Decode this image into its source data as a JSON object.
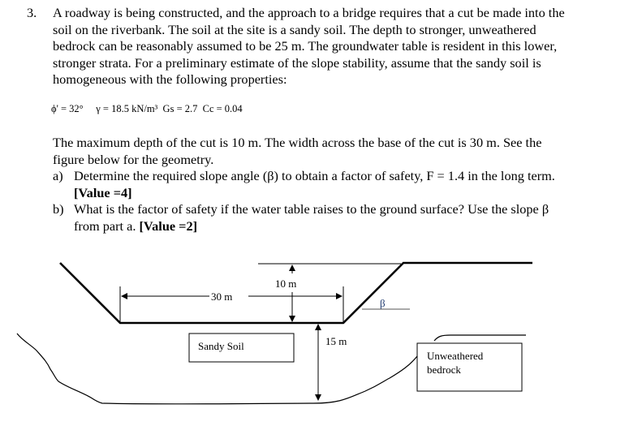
{
  "question": {
    "number": "3.",
    "intro_lines": [
      "A roadway is being constructed, and the approach to a bridge requires that a cut be made into the",
      "soil on the riverbank. The soil at the site is a sandy soil.  The depth to stronger, unweathered",
      "bedrock can be reasonably assumed to be 25 m.  The groundwater table is resident in this lower,",
      "stronger strata.  For a preliminary estimate of the slope stability, assume that the sandy soil is",
      "homogeneous with the following properties:"
    ],
    "properties": "ϕ' = 32°     γ = 18.5 kN/m³  Gs = 2.7  Cc = 0.04",
    "geometry_lines": [
      "The maximum depth of the cut is 10 m. The width across the base of the cut is 30 m.  See the",
      "figure below for the geometry."
    ],
    "parts": [
      {
        "label": "a)",
        "line1": "Determine the required slope angle (β) to obtain a factor of safety, F = 1.4 in the long term.",
        "value": "[Value =4]",
        "line2_prefix": ""
      },
      {
        "label": "b)",
        "line1": "What is the factor of safety if the water table raises to the ground surface?  Use the slope β",
        "line2_prefix": "from part a.  ",
        "value": "[Value =2]"
      }
    ]
  },
  "figure": {
    "width_label": "30 m",
    "depth_label": "10 m",
    "slope_label": "β",
    "thickness_label": "15 m",
    "sandy_soil_label": "Sandy Soil",
    "bedrock_label_line1": "Unweathered",
    "bedrock_label_line2": "bedrock"
  }
}
